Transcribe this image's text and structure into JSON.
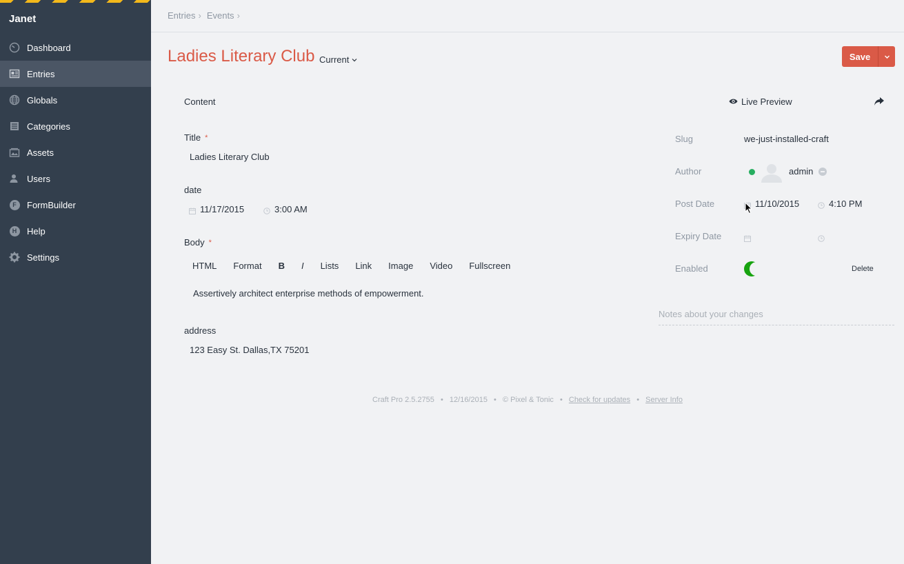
{
  "app": {
    "site_name": "Janet",
    "accent_color": "#da5a47",
    "sidebar_color": "#333f4d"
  },
  "sidebar": {
    "items": [
      {
        "label": "Dashboard",
        "icon": "gauge-icon"
      },
      {
        "label": "Entries",
        "icon": "entries-icon",
        "active": true
      },
      {
        "label": "Globals",
        "icon": "globe-icon"
      },
      {
        "label": "Categories",
        "icon": "categories-icon"
      },
      {
        "label": "Assets",
        "icon": "assets-icon"
      },
      {
        "label": "Users",
        "icon": "users-icon"
      },
      {
        "label": "FormBuilder",
        "icon": "formbuilder-icon",
        "badge": "F"
      },
      {
        "label": "Help",
        "icon": "help-icon",
        "badge": "H"
      },
      {
        "label": "Settings",
        "icon": "gear-icon"
      }
    ]
  },
  "breadcrumb": {
    "items": [
      "Entries",
      "Events"
    ],
    "separator": "›"
  },
  "header": {
    "title": "Ladies Literary Club",
    "revision": "Current",
    "save_label": "Save"
  },
  "tabs": {
    "content": "Content",
    "live_preview": "Live Preview"
  },
  "fields": {
    "title_label": "Title",
    "title_value": "Ladies Literary Club",
    "date_label": "date",
    "date_value": "11/17/2015",
    "time_value": "3:00 AM",
    "body_label": "Body",
    "toolbar": [
      "HTML",
      "Format",
      "B",
      "I",
      "Lists",
      "Link",
      "Image",
      "Video",
      "Fullscreen"
    ],
    "body_value": "Assertively architect enterprise methods of empowerment.",
    "address_label": "address",
    "address_value": "123 Easy St. Dallas,TX 75201",
    "required_mark": "*"
  },
  "meta": {
    "slug_label": "Slug",
    "slug_value": "we-just-installed-craft",
    "author_label": "Author",
    "author_value": "admin",
    "post_date_label": "Post Date",
    "post_date_value": "11/10/2015",
    "post_time_value": "4:10 PM",
    "expiry_date_label": "Expiry Date",
    "enabled_label": "Enabled",
    "enabled": true,
    "delete_label": "Delete",
    "notes_placeholder": "Notes about your changes"
  },
  "footer": {
    "product": "Craft Pro 2.5.2755",
    "date": "12/16/2015",
    "copyright": "© Pixel & Tonic",
    "updates_link": "Check for updates",
    "server_link": "Server Info",
    "bullet": "•"
  }
}
